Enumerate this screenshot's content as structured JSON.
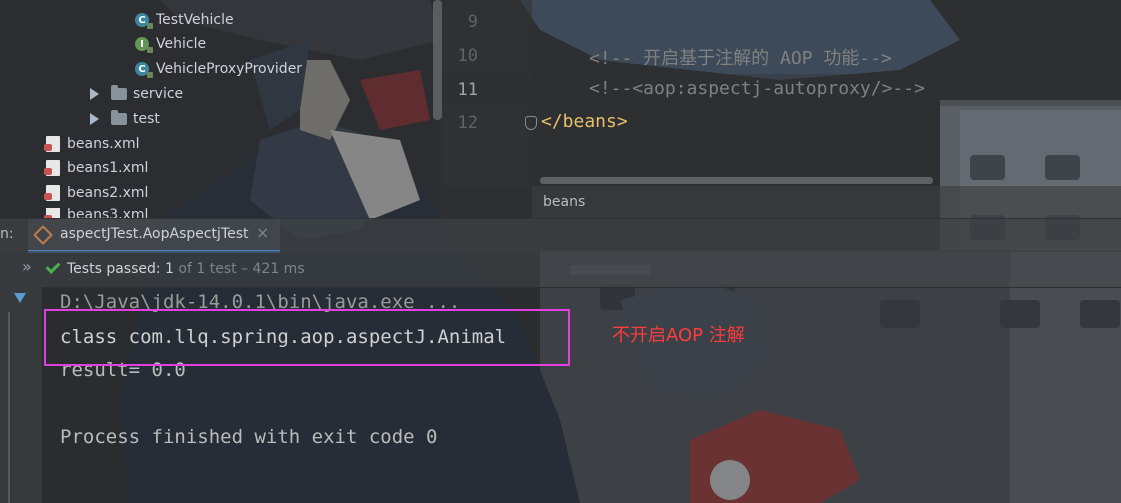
{
  "project_tree": {
    "items": [
      {
        "label": "TestVehicle",
        "icon": "class-icon"
      },
      {
        "label": "Vehicle",
        "icon": "interface-icon"
      },
      {
        "label": "VehicleProxyProvider",
        "icon": "class-icon"
      },
      {
        "label": "service",
        "icon": "folder-icon"
      },
      {
        "label": "test",
        "icon": "folder-icon"
      },
      {
        "label": "beans.xml",
        "icon": "xml-file-icon"
      },
      {
        "label": "beans1.xml",
        "icon": "xml-file-icon"
      },
      {
        "label": "beans2.xml",
        "icon": "xml-file-icon"
      },
      {
        "label": "beans3.xml",
        "icon": "xml-file-icon"
      }
    ],
    "class_icon_letter": "C",
    "interface_icon_letter": "I"
  },
  "editor": {
    "line_numbers": [
      "9",
      "10",
      "11",
      "12"
    ],
    "lines": [
      "<!-- 开启基于注解的 AOP 功能-->",
      "<!--<aop:aspectj-autoproxy/>-->",
      "</beans>"
    ],
    "breadcrumb": "beans"
  },
  "run_panel": {
    "label_prefix": "n:",
    "tab_label": "aspectJTest.AopAspectjTest",
    "close_glyph": "×",
    "expand_glyph": "»",
    "status_passed": "Tests passed: ",
    "status_count": "1",
    "status_rest": " of 1 test – 421 ms",
    "console_lines": [
      "D:\\Java\\jdk-14.0.1\\bin\\java.exe ...",
      "class com.llq.spring.aop.aspectJ.Animal",
      "result= 0.0",
      "",
      "Process finished with exit code 0"
    ]
  },
  "annotation": {
    "text": "不开启AOP 注解",
    "color": "#ff3b3b",
    "box_color": "#e040e0"
  }
}
